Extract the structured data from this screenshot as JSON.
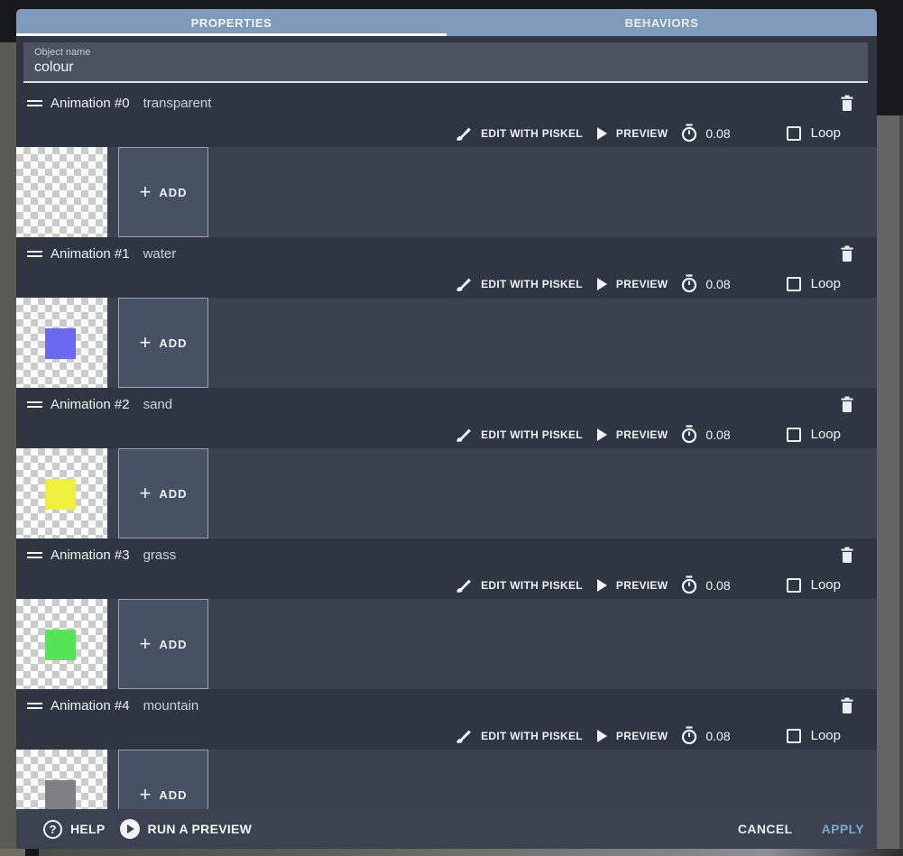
{
  "tabs": [
    {
      "label": "PROPERTIES",
      "active": true
    },
    {
      "label": "BEHAVIORS",
      "active": false
    }
  ],
  "object_name": {
    "label": "Object name",
    "value": "colour"
  },
  "animations": [
    {
      "title": "Animation #0",
      "name": "transparent",
      "swatch": null
    },
    {
      "title": "Animation #1",
      "name": "water",
      "swatch": "#6a6af0"
    },
    {
      "title": "Animation #2",
      "name": "sand",
      "swatch": "#eff03c"
    },
    {
      "title": "Animation #3",
      "name": "grass",
      "swatch": "#55e455"
    },
    {
      "title": "Animation #4",
      "name": "mountain",
      "swatch": "#7e8082"
    }
  ],
  "animation_toolbar": {
    "edit_label": "EDIT WITH PISKEL",
    "preview_label": "PREVIEW",
    "time_value": "0.08",
    "loop_label": "Loop",
    "add_label": "ADD",
    "add_plus_glyph": "+"
  },
  "footer": {
    "help_label": "HELP",
    "help_glyph": "?",
    "run_preview_label": "RUN A PREVIEW",
    "cancel_label": "CANCEL",
    "apply_label": "APPLY"
  },
  "colors": {
    "tab_bar": "#7e9bb9",
    "dialog_dark": "#2f3642",
    "row_light": "#3a4250",
    "object_name_panel": "#4c525f",
    "add_button_bg": "#475164",
    "apply_accent": "#76aacb",
    "checker_light": "#ffffff",
    "checker_dark": "#cbcbcb"
  }
}
